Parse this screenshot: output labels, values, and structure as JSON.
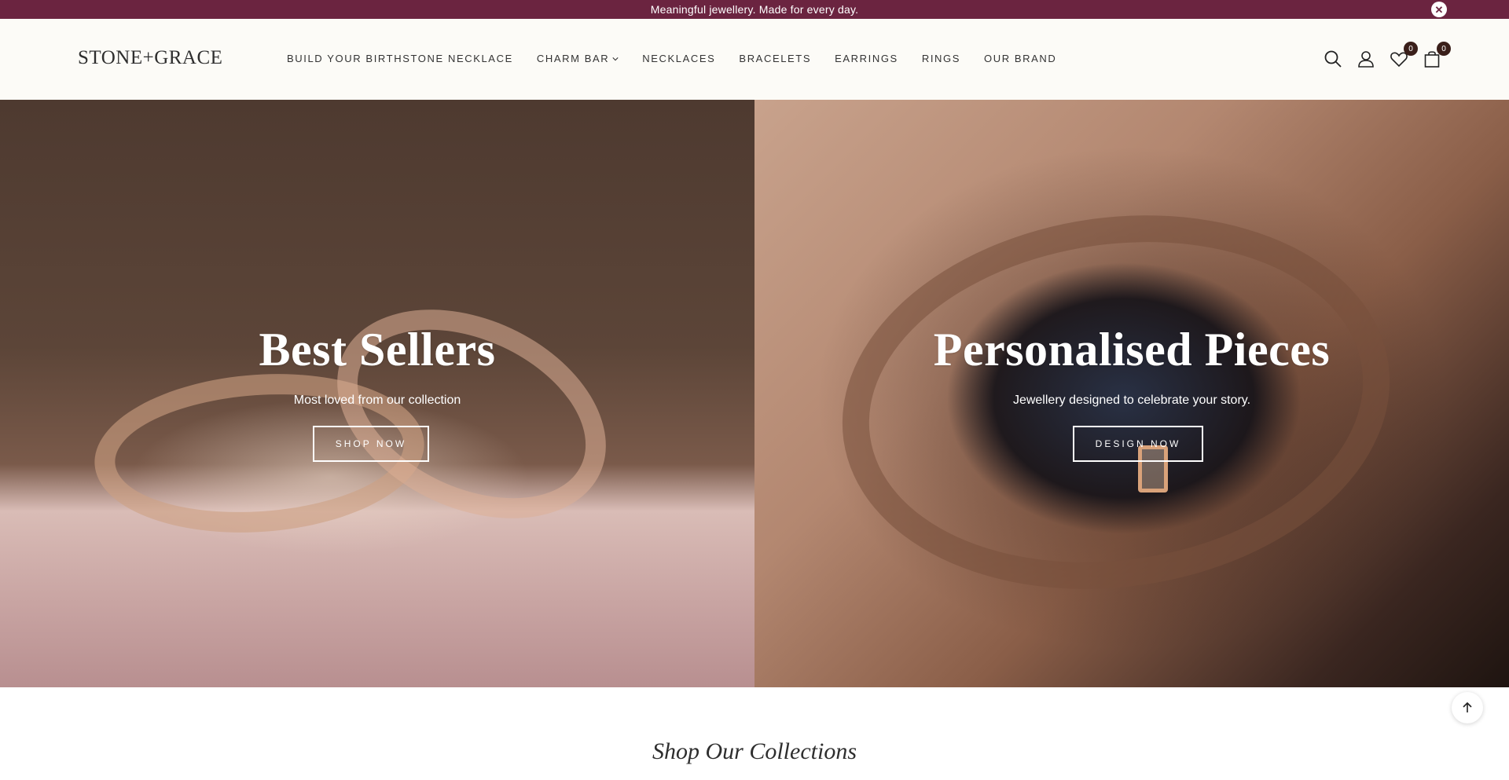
{
  "announcement": {
    "text": "Meaningful jewellery. Made for every day.",
    "close_glyph": "✕"
  },
  "header": {
    "logo": "STONE+GRACE",
    "nav": [
      {
        "label": "BUILD YOUR BIRTHSTONE NECKLACE",
        "dropdown": false
      },
      {
        "label": "CHARM BAR",
        "dropdown": true
      },
      {
        "label": "NECKLACES",
        "dropdown": false
      },
      {
        "label": "BRACELETS",
        "dropdown": false
      },
      {
        "label": "EARRINGS",
        "dropdown": false
      },
      {
        "label": "RINGS",
        "dropdown": false
      },
      {
        "label": "OUR BRAND",
        "dropdown": false
      }
    ],
    "icons": {
      "search": "search-icon",
      "account": "user-icon",
      "wishlist": "heart-icon",
      "cart": "bag-icon"
    },
    "wishlist_count": "0",
    "cart_count": "0"
  },
  "hero": {
    "left": {
      "title": "Best Sellers",
      "subtitle": "Most loved from our collection",
      "button": "SHOP NOW"
    },
    "right": {
      "title": "Personalised Pieces",
      "subtitle": "Jewellery designed to celebrate your story.",
      "button": "DESIGN NOW"
    }
  },
  "collections": {
    "title": "Shop Our Collections"
  },
  "colors": {
    "announcement_bg": "#6b2440",
    "header_bg": "#fcfbf7",
    "badge_bg": "#3a1f1a"
  }
}
